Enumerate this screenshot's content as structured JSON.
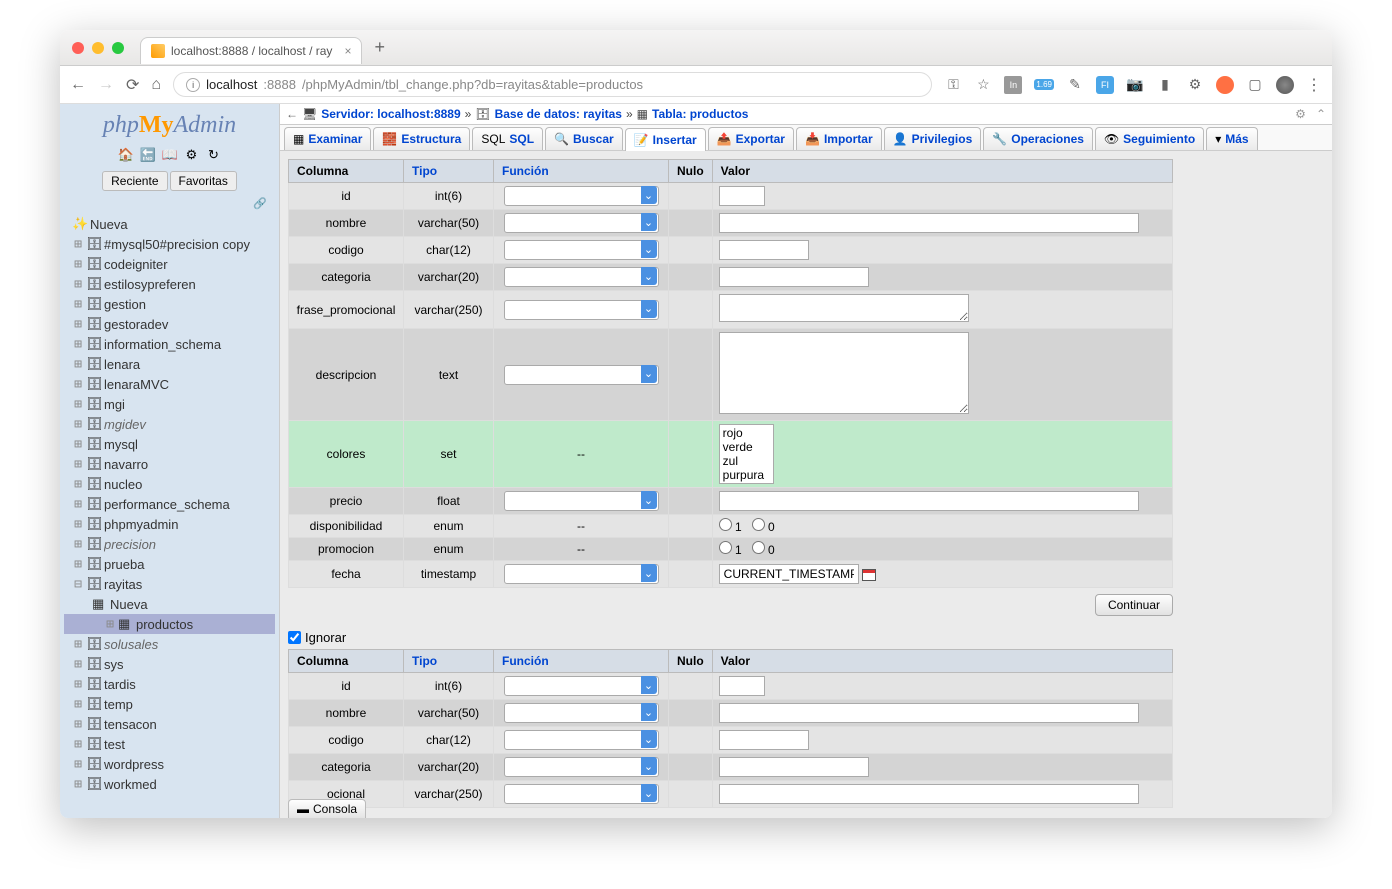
{
  "browser": {
    "tab_title": "localhost:8888 / localhost / ray",
    "url_host": "localhost",
    "url_port": ":8888",
    "url_path": "/phpMyAdmin/tbl_change.php?db=rayitas&table=productos"
  },
  "sidebar": {
    "logo_php": "php",
    "logo_my": "My",
    "logo_admin": "Admin",
    "recent": "Reciente",
    "fav": "Favoritas",
    "new_db": "Nueva",
    "items": [
      {
        "label": "#mysql50#precision copy"
      },
      {
        "label": "codeigniter"
      },
      {
        "label": "estilosypreferen"
      },
      {
        "label": "gestion"
      },
      {
        "label": "gestoradev"
      },
      {
        "label": "information_schema"
      },
      {
        "label": "lenara"
      },
      {
        "label": "lenaraMVC"
      },
      {
        "label": "mgi"
      },
      {
        "label": "mgidev",
        "italic": true
      },
      {
        "label": "mysql"
      },
      {
        "label": "navarro"
      },
      {
        "label": "nucleo"
      },
      {
        "label": "performance_schema"
      },
      {
        "label": "phpmyadmin"
      },
      {
        "label": "precision",
        "italic": true
      },
      {
        "label": "prueba"
      },
      {
        "label": "rayitas",
        "expanded": true,
        "children": [
          {
            "label": "Nueva",
            "new": true
          },
          {
            "label": "productos",
            "selected": true
          }
        ]
      },
      {
        "label": "solusales",
        "italic": true
      },
      {
        "label": "sys"
      },
      {
        "label": "tardis"
      },
      {
        "label": "temp"
      },
      {
        "label": "tensacon"
      },
      {
        "label": "test"
      },
      {
        "label": "wordpress"
      },
      {
        "label": "workmed"
      }
    ]
  },
  "breadcrumb": {
    "server_label": "Servidor:",
    "server_value": "localhost:8889",
    "db_label": "Base de datos:",
    "db_value": "rayitas",
    "table_label": "Tabla:",
    "table_value": "productos"
  },
  "tabs": [
    {
      "label": "Examinar"
    },
    {
      "label": "Estructura"
    },
    {
      "label": "SQL"
    },
    {
      "label": "Buscar"
    },
    {
      "label": "Insertar",
      "active": true
    },
    {
      "label": "Exportar"
    },
    {
      "label": "Importar"
    },
    {
      "label": "Privilegios"
    },
    {
      "label": "Operaciones"
    },
    {
      "label": "Seguimiento"
    },
    {
      "label": "Más",
      "dropdown": true
    }
  ],
  "table_headers": {
    "column": "Columna",
    "type": "Tipo",
    "function": "Función",
    "null": "Nulo",
    "value": "Valor"
  },
  "rows": [
    {
      "col": "id",
      "type": "int(6)",
      "func": "select",
      "val": "input_small",
      "cls": "odd"
    },
    {
      "col": "nombre",
      "type": "varchar(50)",
      "func": "select",
      "val": "input_wide",
      "cls": "even"
    },
    {
      "col": "codigo",
      "type": "char(12)",
      "func": "select",
      "val": "input_med",
      "cls": "odd"
    },
    {
      "col": "categoria",
      "type": "varchar(20)",
      "func": "select",
      "val": "input_medwide",
      "cls": "even"
    },
    {
      "col": "frase_promocional",
      "type": "varchar(250)",
      "func": "select",
      "val": "textarea_short",
      "cls": "odd"
    },
    {
      "col": "descripcion",
      "type": "text",
      "func": "select",
      "val": "textarea_tall",
      "cls": "even"
    },
    {
      "col": "colores",
      "type": "set",
      "func": "dash",
      "val": "setbox",
      "cls": "hl",
      "options": [
        "rojo",
        "verde",
        "zul",
        "purpura"
      ]
    },
    {
      "col": "precio",
      "type": "float",
      "func": "select",
      "val": "input_wide",
      "cls": "even"
    },
    {
      "col": "disponibilidad",
      "type": "enum",
      "func": "dash",
      "val": "radio",
      "cls": "odd",
      "opts": [
        "1",
        "0"
      ]
    },
    {
      "col": "promocion",
      "type": "enum",
      "func": "dash",
      "val": "radio",
      "cls": "even",
      "opts": [
        "1",
        "0"
      ]
    },
    {
      "col": "fecha",
      "type": "timestamp",
      "func": "select",
      "val": "timestamp",
      "cls": "odd",
      "default": "CURRENT_TIMESTAMP"
    }
  ],
  "rows2": [
    {
      "col": "id",
      "type": "int(6)",
      "func": "select",
      "val": "input_small",
      "cls": "odd"
    },
    {
      "col": "nombre",
      "type": "varchar(50)",
      "func": "select",
      "val": "input_wide",
      "cls": "even"
    },
    {
      "col": "codigo",
      "type": "char(12)",
      "func": "select",
      "val": "input_med",
      "cls": "odd"
    },
    {
      "col": "categoria",
      "type": "varchar(20)",
      "func": "select",
      "val": "input_medwide",
      "cls": "even"
    },
    {
      "col": "ocional",
      "type": "varchar(250)",
      "func": "select",
      "val": "input_wide",
      "cls": "odd"
    }
  ],
  "continue": "Continuar",
  "ignore": "Ignorar",
  "consola": "Consola",
  "dash": "--"
}
